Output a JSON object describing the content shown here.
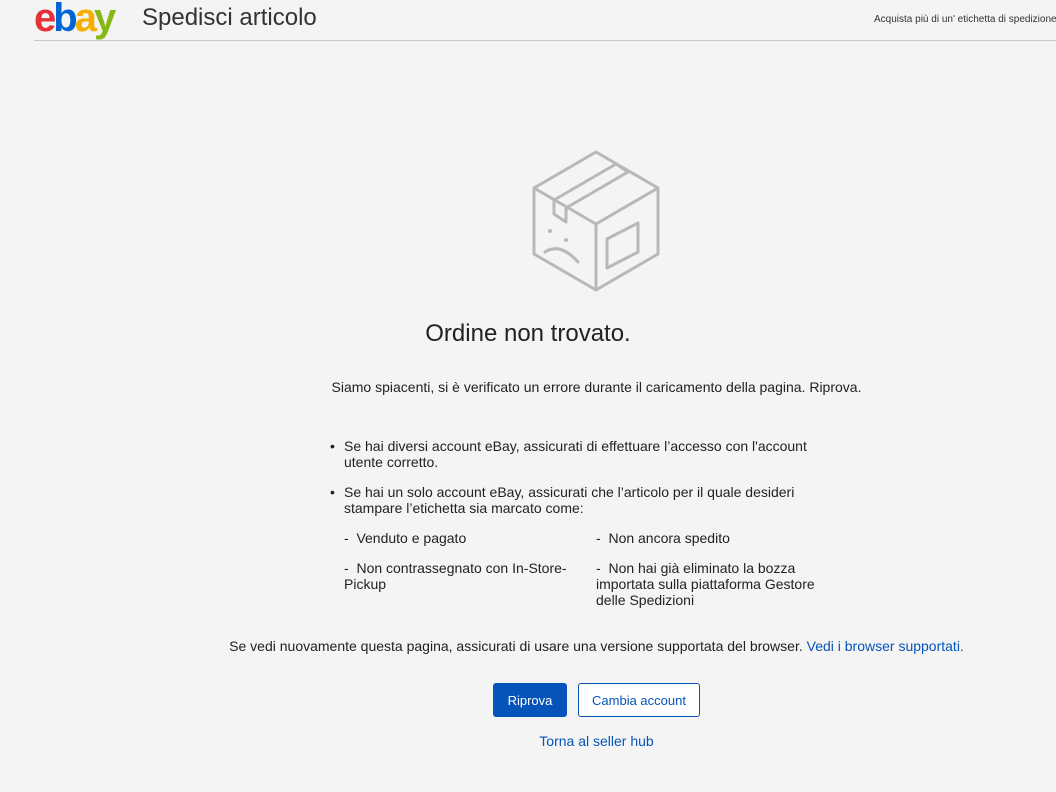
{
  "header": {
    "logo": {
      "e": "e",
      "b": "b",
      "a": "a",
      "y": "y"
    },
    "title": "Spedisci articolo",
    "top_link": "Acquista più di un' etichetta di spedizione"
  },
  "main": {
    "illustration_icon": "sad-box-icon",
    "heading": "Ordine non trovato.",
    "subtitle": "Siamo spiacenti, si è verificato un errore durante il caricamento della pagina. Riprova.",
    "tips": [
      "Se hai diversi account eBay, assicurati di effettuare l’accesso con l'account utente corretto.",
      "Se hai un solo account eBay, assicurati che l’articolo per il quale desideri stampare l’etichetta sia marcato come:"
    ],
    "statuses": [
      "Venduto e pagato",
      "Non ancora spedito",
      "Non contrassegnato con In-Store-Pickup",
      "Non hai già eliminato la bozza importata sulla piattaforma Gestore delle Spedizioni"
    ],
    "bullet": "•",
    "dash": "-",
    "browser_note": "Se vedi nuovamente questa pagina, assicurati di usare una versione supportata del browser.",
    "browser_link": "Vedi i browser supportati.",
    "retry_button": "Riprova",
    "change_account_button": "Cambia account",
    "back_link": "Torna al seller hub"
  },
  "colors": {
    "accent": "#0654ba",
    "background": "#f4f4f4"
  }
}
